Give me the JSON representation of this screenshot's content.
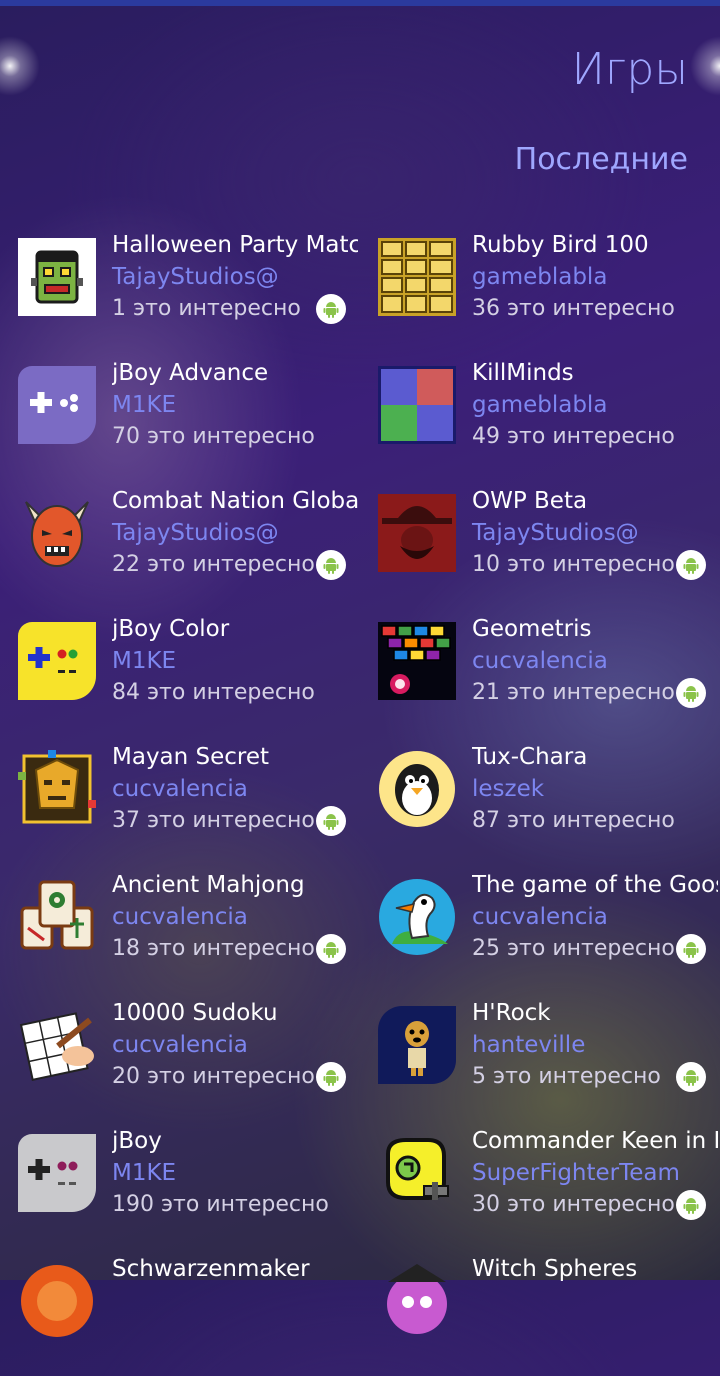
{
  "header": {
    "title": "Игры",
    "section": "Последние"
  },
  "games": [
    {
      "name": "Halloween Party Match",
      "author": "TajayStudios@",
      "likes": "1 это интересно",
      "android": true,
      "icon": "frankenstein-icon"
    },
    {
      "name": "Rubby Bird 100",
      "author": "gameblabla",
      "likes": "36 это интересно",
      "android": false,
      "icon": "golden-blocks-icon"
    },
    {
      "name": "jBoy Advance",
      "author": "M1KE",
      "likes": "70 это интересно",
      "android": false,
      "icon": "gamepad-purple-icon"
    },
    {
      "name": "KillMinds",
      "author": "gameblabla",
      "likes": "49 это интересно",
      "android": false,
      "icon": "color-squares-icon"
    },
    {
      "name": "Combat Nation Global",
      "author": "TajayStudios@",
      "likes": "22 это интересно",
      "android": true,
      "icon": "demon-mask-icon"
    },
    {
      "name": "OWP Beta",
      "author": "TajayStudios@",
      "likes": "10 это интересно",
      "android": true,
      "icon": "cowboy-icon"
    },
    {
      "name": "jBoy Color",
      "author": "M1KE",
      "likes": "84 это интересно",
      "android": false,
      "icon": "gamepad-yellow-icon"
    },
    {
      "name": "Geometris",
      "author": "cucvalencia",
      "likes": "21 это интересно",
      "android": true,
      "icon": "neon-tiles-icon"
    },
    {
      "name": "Mayan Secret",
      "author": "cucvalencia",
      "likes": "37 это интересно",
      "android": true,
      "icon": "mayan-mask-icon"
    },
    {
      "name": "Tux-Chara",
      "author": "leszek",
      "likes": "87 это интересно",
      "android": false,
      "icon": "penguin-icon"
    },
    {
      "name": "Ancient Mahjong",
      "author": "cucvalencia",
      "likes": "18 это интересно",
      "android": true,
      "icon": "mahjong-tiles-icon"
    },
    {
      "name": "The game of the Goose",
      "author": "cucvalencia",
      "likes": "25 это интересно",
      "android": true,
      "icon": "goose-icon"
    },
    {
      "name": "10000 Sudoku",
      "author": "cucvalencia",
      "likes": "20 это интересно",
      "android": true,
      "icon": "sudoku-pencil-icon"
    },
    {
      "name": "H'Rock",
      "author": "hanteville",
      "likes": "5 это интересно",
      "android": true,
      "icon": "dog-character-icon"
    },
    {
      "name": "jBoy",
      "author": "M1KE",
      "likes": "190 это интересно",
      "android": false,
      "icon": "gamepad-gray-icon"
    },
    {
      "name": "Commander Keen in Ke",
      "author": "SuperFighterTeam",
      "likes": "30 это интересно",
      "android": true,
      "icon": "keen-helmet-icon"
    },
    {
      "name": "Schwarzenmaker",
      "author": "",
      "likes": "",
      "android": false,
      "icon": "orange-icon"
    },
    {
      "name": "Witch Spheres",
      "author": "",
      "likes": "",
      "android": false,
      "icon": "witch-icon"
    }
  ]
}
